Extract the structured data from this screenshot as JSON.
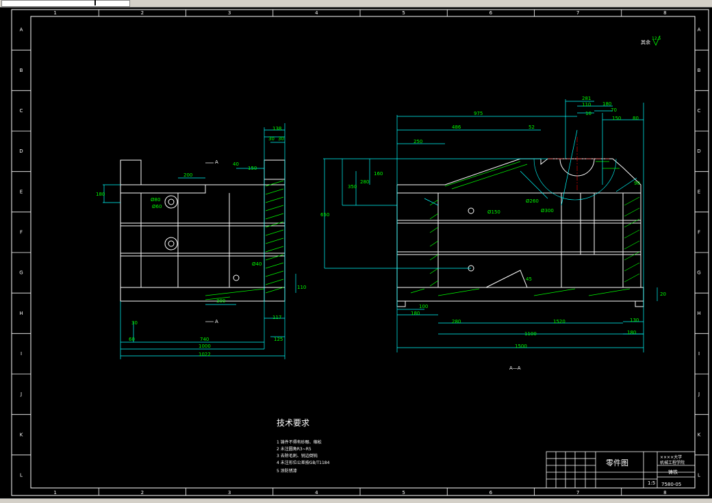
{
  "frame": {
    "col_labels": [
      "1",
      "2",
      "3",
      "4",
      "5",
      "6",
      "7",
      "8"
    ],
    "row_labels": [
      "A",
      "B",
      "C",
      "D",
      "E",
      "F",
      "G",
      "H",
      "I",
      "J",
      "K",
      "L"
    ]
  },
  "roughness_note": {
    "label": "其余",
    "value": "12.5"
  },
  "section_marks": {
    "top": "A",
    "bottom": "A",
    "caption": "A—A"
  },
  "left_view_dims": {
    "d138": "138",
    "d30a": "30",
    "d30b": "30",
    "d150": "150",
    "d40": "40",
    "d200": "200",
    "d180": "180",
    "d300": "300",
    "d110": "110",
    "d30c": "30",
    "d60": "60",
    "d740": "740",
    "d1000": "1000",
    "d1022": "1022",
    "d117": "117",
    "d125": "125",
    "phi80": "Ø80",
    "phi60": "Ø60",
    "phi40": "Ø40"
  },
  "right_view_dims": {
    "d975": "975",
    "d486": "486",
    "d250": "250",
    "d52": "52",
    "d281": "281",
    "d80": "80",
    "d110": "110",
    "d10": "10",
    "d180": "180",
    "d70": "70",
    "d150": "150",
    "d90": "90",
    "d350": "350",
    "d280": "280",
    "d160": "160",
    "d650": "650",
    "d100": "100",
    "d180b": "180",
    "d280b": "280",
    "d1520": "1520",
    "d1100": "1100",
    "d1500": "1500",
    "d130": "130",
    "d180c": "180",
    "d20": "20",
    "d45": "45",
    "phi150": "Ø150",
    "phi260": "Ø260",
    "phi300": "Ø300"
  },
  "tech_req": {
    "title": "技术要求",
    "items": [
      "1 铸件不得有砂眼、缩松",
      "2 未注圆角R3~R5",
      "3 去除毛刺、锐边倒钝",
      "4 未注形位公差按GB/T1184",
      "5 涂防锈漆"
    ]
  },
  "title_block": {
    "part_label": "零件图",
    "school": "××××大学",
    "school_sub": "机械工程学院",
    "material": "铸铁",
    "scale": "1:5",
    "drawing_no": "7580-05"
  },
  "colors": {
    "frame": "#ffffff",
    "outline": "#ffffff",
    "dimension": "#00ffff",
    "dim_text": "#00ff00",
    "hatch": "#00ff00",
    "center": "#ff0000"
  }
}
